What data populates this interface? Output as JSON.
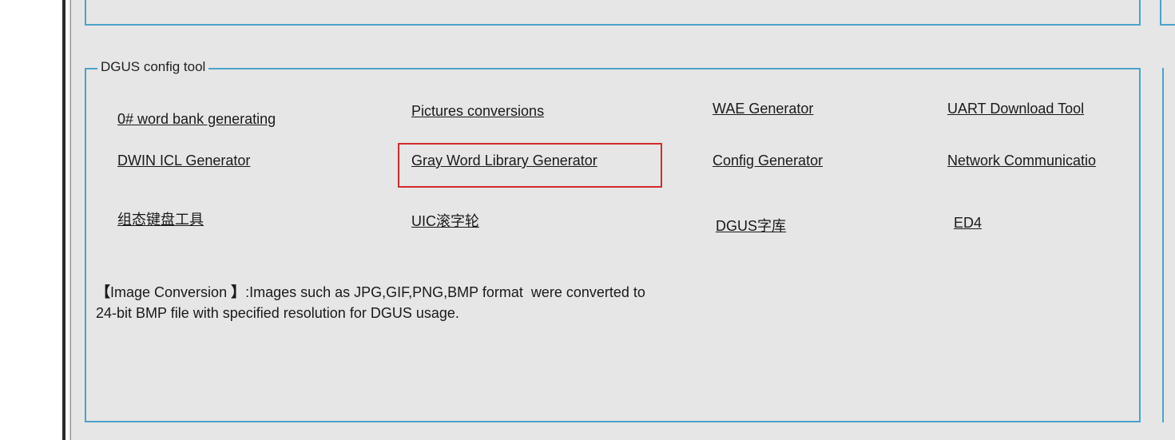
{
  "group": {
    "title": "DGUS config tool"
  },
  "tools": {
    "word_bank": "0# word bank generating",
    "pictures_conversions": "Pictures conversions",
    "wae_generator": "WAE Generator",
    "uart_download_tool": "UART Download Tool",
    "dwin_icl_generator": "DWIN ICL Generator",
    "gray_word_library_generator": "Gray Word Library Generator",
    "config_generator": "Config Generator",
    "network_communication": "Network Communicatio",
    "keyboard_tool": "组态键盘工具",
    "uic_scroll_wheel": "UIC滚字轮",
    "dgus_font_library": "DGUS字库",
    "ed4": "ED4"
  },
  "description": {
    "bracket_left": "【",
    "label": "Image Conversion ",
    "bracket_right": "】",
    "line1_rest": ":Images such as JPG,GIF,PNG,BMP format  were converted to",
    "line2": "24-bit BMP file with specified resolution for DGUS usage."
  },
  "highlight": {
    "color": "#d42a2a",
    "target": "gray_word_library_generator"
  },
  "colors": {
    "groupbox_border": "#4aa3c9",
    "panel_background": "#e6e6e6"
  }
}
